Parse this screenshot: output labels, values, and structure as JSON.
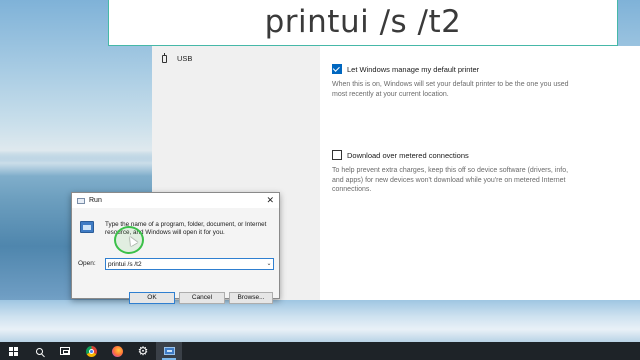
{
  "caption": {
    "text": "printui /s /t2"
  },
  "settings": {
    "nav_usb_label": "USB",
    "default_printer": {
      "label": "Let Windows manage my default printer",
      "checked": true,
      "description": "When this is on, Windows will set your default printer to be the one you used most recently at your current location."
    },
    "metered": {
      "label": "Download over metered connections",
      "checked": false,
      "description": "To help prevent extra charges, keep this off so device software (drivers, info, and apps) for new devices won't download while you're on metered Internet connections."
    }
  },
  "run_dialog": {
    "title": "Run",
    "close_glyph": "✕",
    "description": "Type the name of a program, folder, document, or Internet resource, and Windows will open it for you.",
    "open_label": "Open:",
    "input_value": "printui /s /t2",
    "dropdown_glyph": "⌄",
    "ok_label": "OK",
    "cancel_label": "Cancel",
    "browse_label": "Browse..."
  },
  "taskbar": {
    "gear_glyph": "⚙",
    "items": [
      "start-icon",
      "search-icon",
      "task-view-icon",
      "chrome-icon",
      "firefox-icon",
      "settings-gear-icon",
      "run-icon"
    ]
  },
  "colors": {
    "accent": "#0067c0",
    "caption_border": "#46b8a8",
    "taskbar": "#1e2328",
    "cursor_ring": "#3cc04a"
  }
}
